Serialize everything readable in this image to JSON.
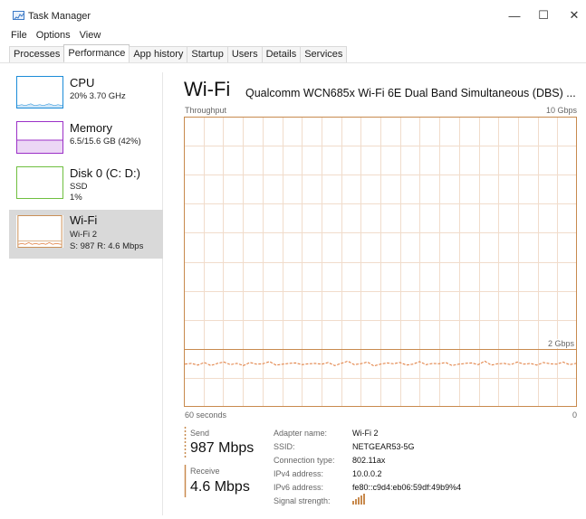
{
  "window": {
    "title": "Task Manager",
    "minimize_glyph": "—",
    "maximize_glyph": "☐",
    "close_glyph": "✕"
  },
  "menu": {
    "items": [
      "File",
      "Options",
      "View"
    ]
  },
  "tabs": [
    {
      "label": "Processes"
    },
    {
      "label": "Performance",
      "active": true
    },
    {
      "label": "App history"
    },
    {
      "label": "Startup"
    },
    {
      "label": "Users"
    },
    {
      "label": "Details"
    },
    {
      "label": "Services"
    }
  ],
  "sidebar": {
    "items": [
      {
        "name": "CPU",
        "line1": "20%  3.70 GHz",
        "color": "#1c8cd8"
      },
      {
        "name": "Memory",
        "line1": "6.5/15.6 GB (42%)",
        "color": "#9b30c7"
      },
      {
        "name": "Disk 0 (C: D:)",
        "line1": "SSD",
        "line2": "1%",
        "color": "#6fbf3f"
      },
      {
        "name": "Wi-Fi",
        "line1": "Wi-Fi 2",
        "line2": "S: 987  R: 4.6 Mbps",
        "color": "#c88a4e",
        "selected": true
      }
    ]
  },
  "main": {
    "title": "Wi-Fi",
    "adapter": "Qualcomm WCN685x Wi-Fi 6E Dual Band Simultaneous (DBS) ...",
    "throughput_label": "Throughput",
    "max_label": "10 Gbps",
    "mid_label": "2 Gbps",
    "time_label": "60 seconds",
    "zero_label": "0",
    "graph_color": "#c88a4e",
    "graph_line_color": "#e07a3a"
  },
  "stats": {
    "send_label": "Send",
    "send_value": "987 Mbps",
    "receive_label": "Receive",
    "receive_value": "4.6 Mbps",
    "details": [
      {
        "key": "Adapter name:",
        "value": "Wi-Fi 2"
      },
      {
        "key": "SSID:",
        "value": "NETGEAR53-5G"
      },
      {
        "key": "Connection type:",
        "value": "802.11ax"
      },
      {
        "key": "IPv4 address:",
        "value": "10.0.0.2"
      },
      {
        "key": "IPv6 address:",
        "value": "fe80::c9d4:eb06:59df:49b9%4"
      },
      {
        "key": "Signal strength:",
        "value": ""
      }
    ]
  },
  "chart_data": {
    "type": "line",
    "x": [
      0,
      1,
      2,
      3,
      4,
      5,
      6,
      7,
      8,
      9,
      10,
      11,
      12,
      13,
      14,
      15,
      16,
      17,
      18,
      19,
      20,
      21,
      22,
      23,
      24,
      25,
      26,
      27,
      28,
      29,
      30,
      31,
      32,
      33,
      34,
      35,
      36,
      37,
      38,
      39,
      40,
      41,
      42,
      43,
      44,
      45,
      46,
      47,
      48,
      49,
      50,
      51,
      52,
      53,
      54,
      55,
      56,
      57,
      58,
      59,
      60
    ],
    "series": [
      {
        "values": [
          0.98,
          1.0,
          0.96,
          1.02,
          0.95,
          1.0,
          1.03,
          0.97,
          1.0,
          0.95,
          1.02,
          0.98,
          0.99,
          1.04,
          0.96,
          0.98,
          1.0,
          1.01,
          0.97,
          0.99,
          1.0,
          0.98,
          1.02,
          0.95,
          1.0,
          1.05,
          0.97,
          0.99,
          1.03,
          0.94,
          0.98,
          1.01,
          0.99,
          1.02,
          0.96,
          0.98,
          1.04,
          0.97,
          1.0,
          0.99,
          1.02,
          0.95,
          0.98,
          1.0,
          1.01,
          0.97,
          1.05,
          0.96,
          0.99,
          1.0,
          0.97,
          1.03,
          0.98,
          1.0,
          0.96,
          1.02,
          0.99,
          0.98,
          1.03,
          0.97,
          1.0
        ]
      }
    ],
    "ylim": [
      0,
      10
    ],
    "xlabel": "60 seconds",
    "ylabel": "Throughput"
  }
}
